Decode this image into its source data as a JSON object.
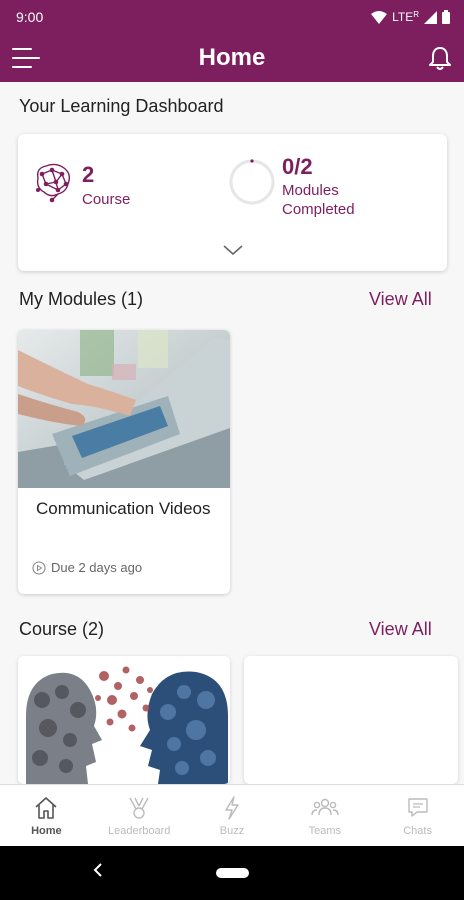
{
  "status_bar": {
    "time": "9:00",
    "network": "LTE",
    "roaming": "R"
  },
  "app_bar": {
    "title": "Home"
  },
  "dashboard": {
    "heading": "Your Learning Dashboard",
    "course_count": "2",
    "course_label": "Course",
    "modules_value": "0/2",
    "modules_label_line1": "Modules",
    "modules_label_line2": "Completed",
    "modules_progress": 0
  },
  "my_modules": {
    "heading": "My Modules (1)",
    "view_all": "View All",
    "items": [
      {
        "title": "Communication Videos",
        "due": "Due 2 days ago"
      }
    ]
  },
  "course": {
    "heading": "Course (2)",
    "view_all": "View All"
  },
  "bottom_nav": {
    "items": [
      {
        "label": "Home",
        "icon": "home-icon",
        "active": true
      },
      {
        "label": "Leaderboard",
        "icon": "trophy-icon",
        "active": false
      },
      {
        "label": "Buzz",
        "icon": "lightning-icon",
        "active": false
      },
      {
        "label": "Teams",
        "icon": "people-icon",
        "active": false
      },
      {
        "label": "Chats",
        "icon": "chat-icon",
        "active": false
      }
    ]
  },
  "colors": {
    "brand": "#7d1f5e",
    "background": "#f7f7f7"
  }
}
